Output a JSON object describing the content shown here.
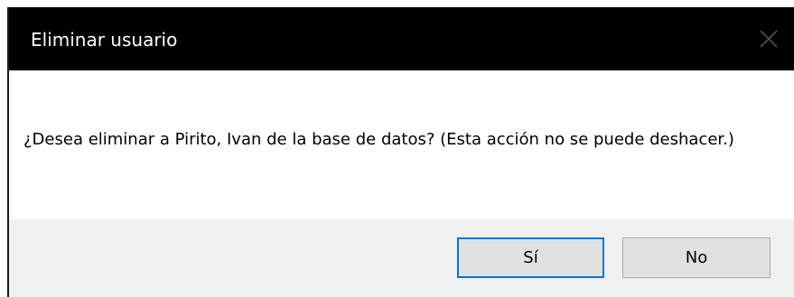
{
  "dialog": {
    "title": "Eliminar usuario",
    "close_icon": "close-icon",
    "message": "¿Desea eliminar a Pirito, Ivan de la base de datos? (Esta acción no se puede deshacer.)",
    "buttons": {
      "yes_label": "Sí",
      "no_label": "No"
    }
  },
  "colors": {
    "titlebar": "#000000",
    "title_text": "#ffffff",
    "content_bg": "#ffffff",
    "footer_bg": "#f0f0f0",
    "button_bg": "#e1e1e1",
    "focus_border": "#0078d7"
  }
}
